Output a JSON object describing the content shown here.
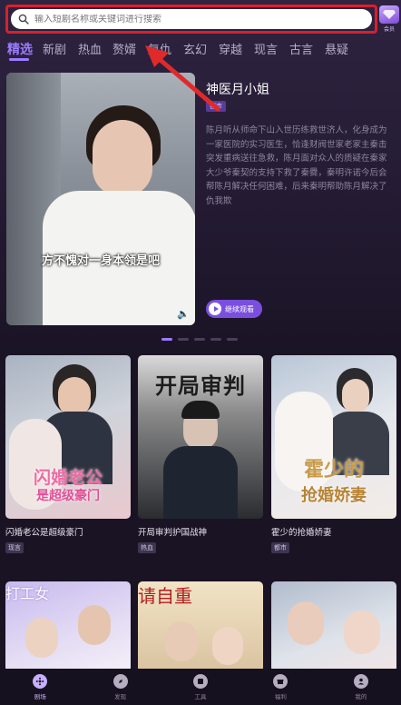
{
  "search": {
    "placeholder": "输入短剧名称或关键词进行搜索"
  },
  "vip": {
    "label": "会员"
  },
  "tabs": [
    "精选",
    "新剧",
    "热血",
    "赘婿",
    "复仇",
    "玄幻",
    "穿越",
    "现言",
    "古言",
    "悬疑"
  ],
  "featured": {
    "subtitle": "方不愧对一身本领是吧",
    "title": "神医月小姐",
    "badge": "都市",
    "description": "陈月听从师命下山入世历练救世济人，化身成为一家医院的实习医生，恰逢财阀世家老家主秦击突发重病送往急救，陈月面对众人的质疑在秦家大少爷秦契的支持下救了秦爨，秦明许诺今后会帮陈月解决任何困难，后来秦明帮助陈月解决了仇我欺",
    "watch_label": "继续观看"
  },
  "cards": [
    {
      "title": "闪婚老公是超级豪门",
      "tag": "现言"
    },
    {
      "title": "开局审判护国战神",
      "tag": "热血"
    },
    {
      "title": "霍少的抢婚娇妻",
      "tag": "都市"
    }
  ],
  "posters": {
    "card1": {
      "line1": "闪婚老公",
      "line2": "是超级豪门"
    },
    "card2": {
      "line1": "开局审判"
    },
    "card3": {
      "line1": "霍少的",
      "line2": "抢婚娇妻"
    },
    "row2_1": {
      "line1": "打工女"
    },
    "row2_2": {
      "line1": "请自重"
    }
  },
  "nav": [
    {
      "label": "剧场",
      "active": true
    },
    {
      "label": "发现"
    },
    {
      "label": "工具"
    },
    {
      "label": "福利"
    },
    {
      "label": "我的"
    }
  ],
  "colors": {
    "accent": "#9b7bff",
    "highlight_box": "#d8202a",
    "background": "#1a1324"
  }
}
